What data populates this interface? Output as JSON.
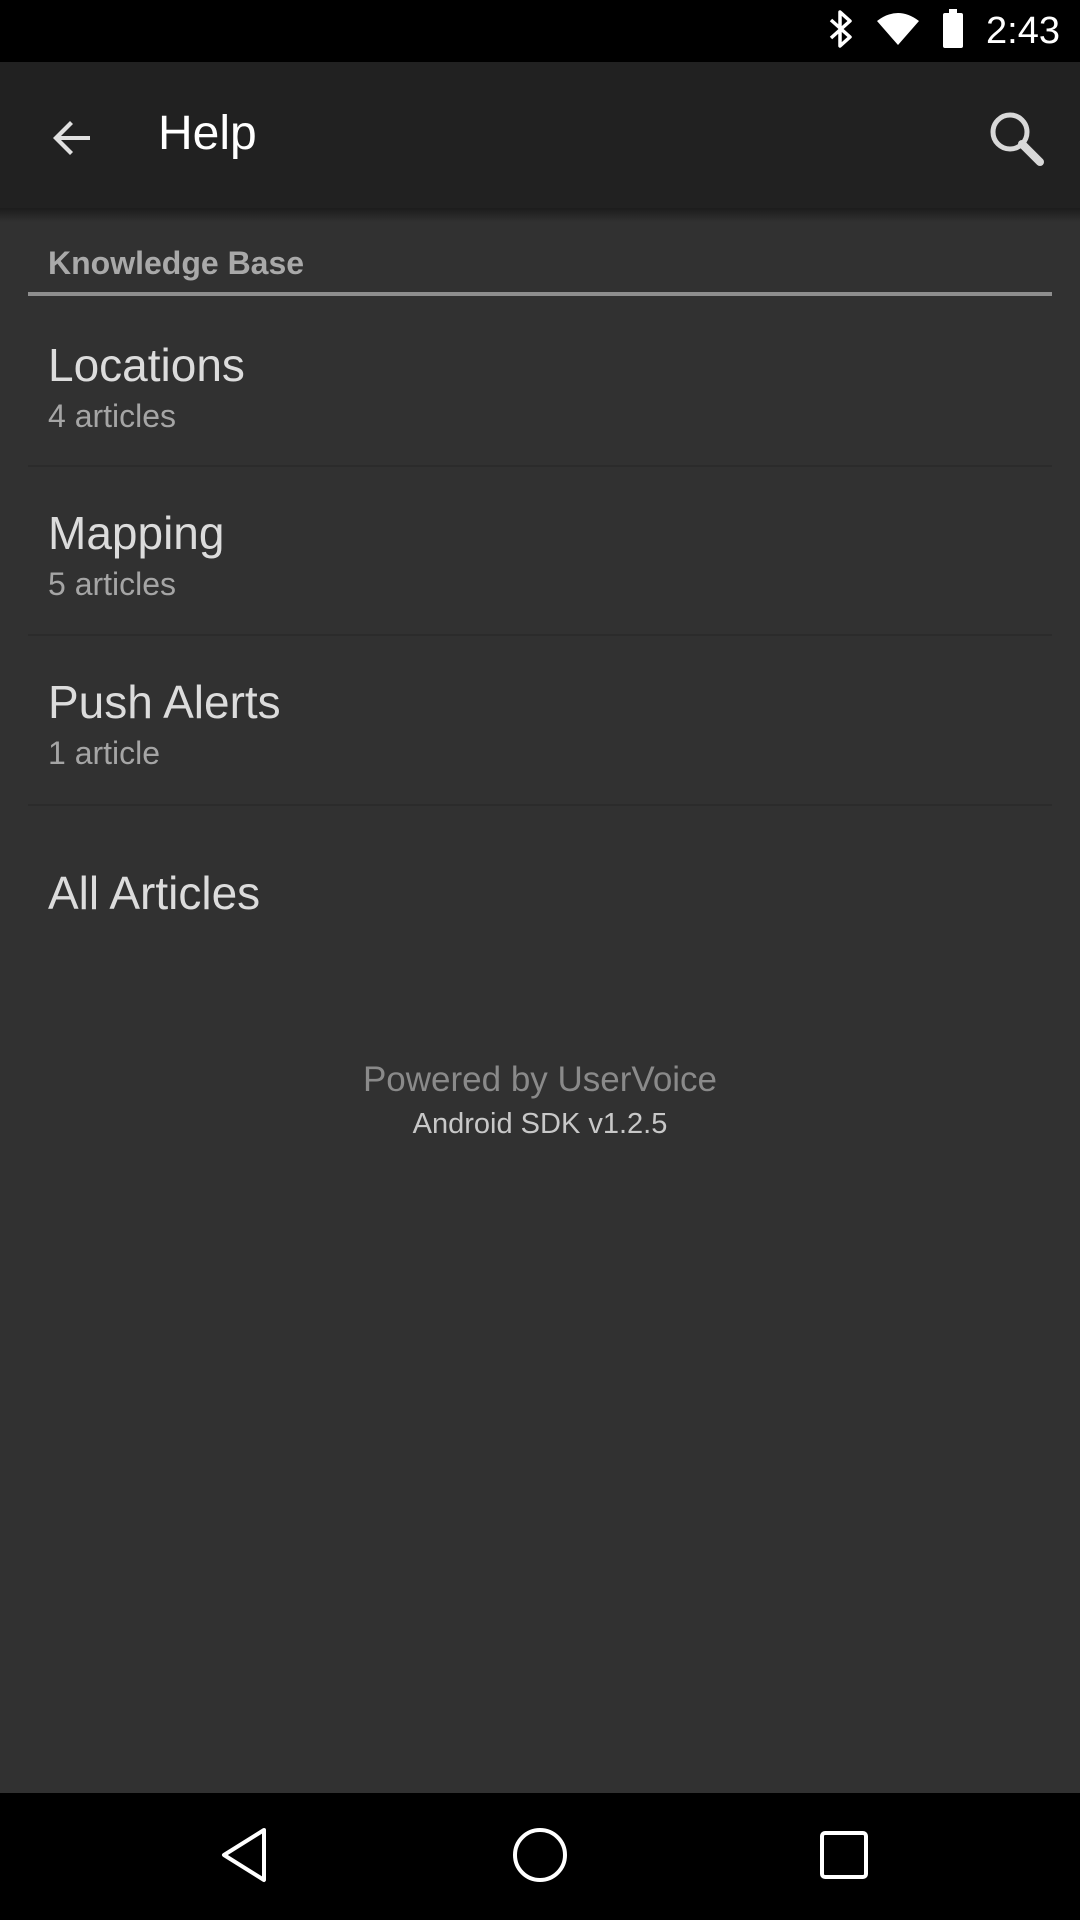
{
  "status_bar": {
    "time": "2:43",
    "icons": [
      "bluetooth-icon",
      "wifi-icon",
      "battery-icon"
    ]
  },
  "app_bar": {
    "title": "Help",
    "back_icon": "arrow-back-icon",
    "search_icon": "search-icon"
  },
  "knowledge_base": {
    "header": "Knowledge Base",
    "items": [
      {
        "title": "Locations",
        "count": "4 articles"
      },
      {
        "title": "Mapping",
        "count": "5 articles"
      },
      {
        "title": "Push Alerts",
        "count": "1 article"
      }
    ],
    "all_articles": "All Articles"
  },
  "footer": {
    "powered_by": "Powered by UserVoice",
    "sdk_version": "Android SDK v1.2.5"
  },
  "nav_bar": {
    "icons": [
      "back-triangle-icon",
      "home-circle-icon",
      "recents-square-icon"
    ]
  },
  "colors": {
    "background": "#313131",
    "app_bar": "#212121",
    "text_primary": "#dcdcdc",
    "text_secondary": "#a5a5a5"
  }
}
